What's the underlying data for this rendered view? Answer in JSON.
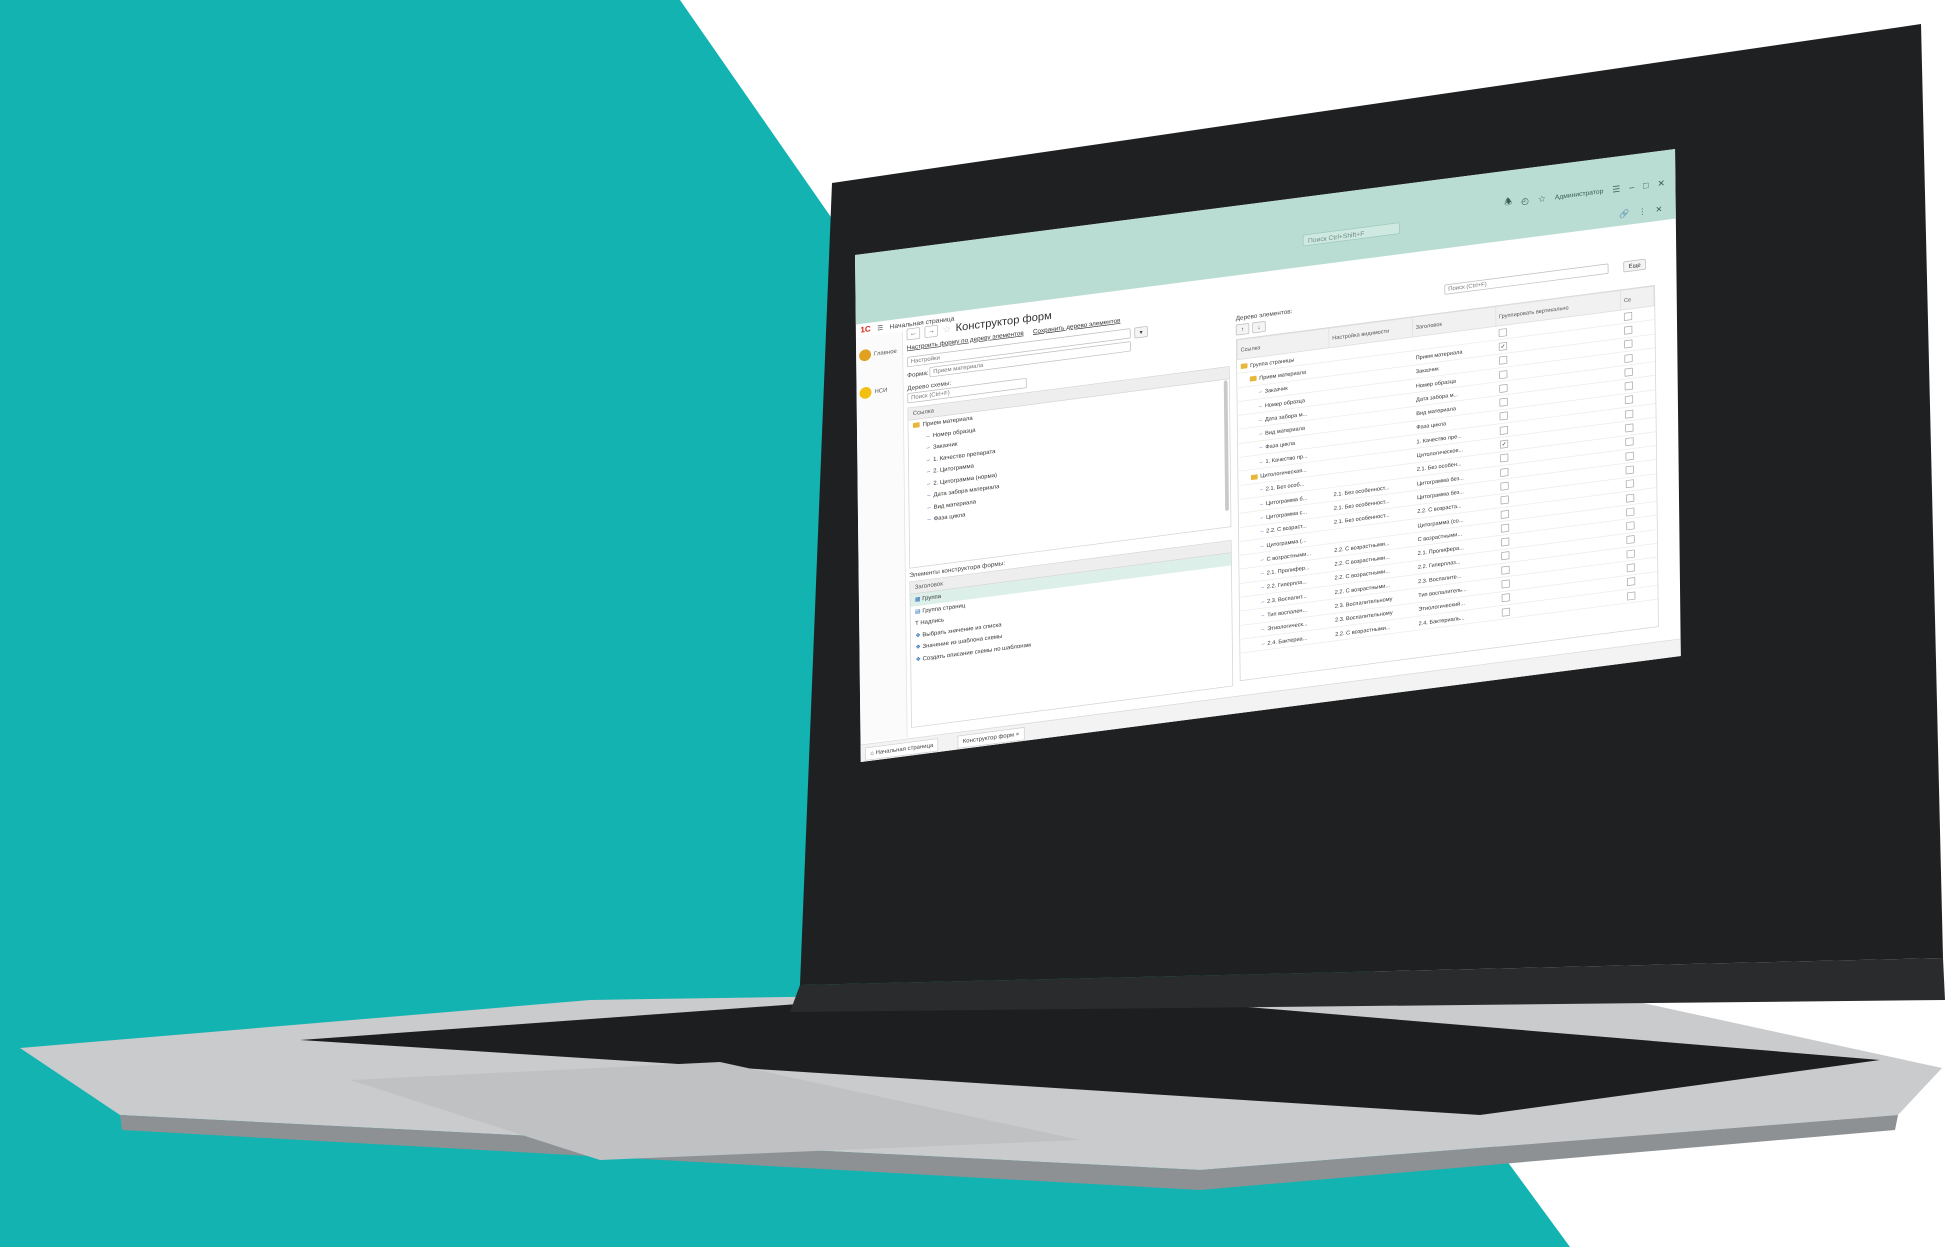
{
  "colors": {
    "teal_bg": "#12b3b1",
    "titlebar": "#b9ddd3",
    "laptop_bezel": "#1f2021",
    "laptop_body": "#cfd1d3"
  },
  "titlebar": {
    "search_placeholder": "Поиск Ctrl+Shift+F",
    "icons": [
      "bell-icon",
      "history-icon",
      "star-icon"
    ],
    "user_name": "Администратор",
    "window_icons": [
      "menu-icon",
      "minimize-icon",
      "maximize-icon",
      "close-icon"
    ],
    "right_icons": [
      "link-icon",
      "more-icon",
      "close-icon"
    ]
  },
  "topnav": {
    "logo": "1С",
    "title": "Начальная страница"
  },
  "rail": [
    {
      "label": "Главное",
      "icon": "home-icon",
      "color": "#e0a020"
    },
    {
      "label": "НСИ",
      "icon": "coin-icon",
      "color": "#f2c012"
    }
  ],
  "form": {
    "title": "Конструктор форм",
    "link1": "Настроить форму по дереву элементов",
    "link2": "Сохранить дерево элементов",
    "more_button": "Еще"
  },
  "left": {
    "settings_label": "Настройки",
    "form_label": "Форма:",
    "form_value": "Прием материала",
    "tree_label": "Дерево схемы:",
    "tree_search": "Поиск (Ctrl+F)",
    "tree_header": "Ссылка",
    "tree_rows": [
      {
        "text": "Прием материала",
        "level": 0,
        "type": "folder"
      },
      {
        "text": "Номер образца",
        "level": 1,
        "type": "item"
      },
      {
        "text": "Заказчик",
        "level": 1,
        "type": "item"
      },
      {
        "text": "1. Качество препарата",
        "level": 1,
        "type": "item"
      },
      {
        "text": "2. Цитограмма",
        "level": 1,
        "type": "item"
      },
      {
        "text": "2. Цитограмма (норма)",
        "level": 1,
        "type": "item"
      },
      {
        "text": "Дата забора материала",
        "level": 1,
        "type": "item"
      },
      {
        "text": "Вид материала",
        "level": 1,
        "type": "item"
      },
      {
        "text": "Фаза цикла",
        "level": 1,
        "type": "item"
      }
    ],
    "constructor_label": "Элементы конструктора формы:",
    "constructor_header": "Заголовок",
    "constructor_rows": [
      {
        "text": "Группа",
        "icon": "group-icon"
      },
      {
        "text": "Группа страниц",
        "icon": "pages-icon"
      },
      {
        "text": "Надпись",
        "icon": "text-icon"
      },
      {
        "text": "Выбрать значение из списка",
        "icon": "list-icon"
      },
      {
        "text": "Значение из шаблона схемы",
        "icon": "template-icon"
      },
      {
        "text": "Создать описание схемы по шаблонам",
        "icon": "create-icon"
      }
    ]
  },
  "right": {
    "tree_label": "Дерево элементов:",
    "search_placeholder": "Поиск (Ctrl+F)",
    "more_button": "Еще",
    "columns": [
      "Ссылка",
      "Настройка видимости",
      "Заголовок",
      "Группировать вертикально",
      "Се"
    ],
    "rows": [
      {
        "link": "Группа страницы",
        "vis": "",
        "title": "",
        "group": false,
        "level": 0,
        "folder": true
      },
      {
        "link": "Прием материала",
        "vis": "",
        "title": "Прием материала",
        "group": true,
        "level": 1,
        "folder": true
      },
      {
        "link": "Заказчик",
        "vis": "",
        "title": "Заказчик",
        "group": false,
        "level": 2,
        "folder": false
      },
      {
        "link": "Номер образца",
        "vis": "",
        "title": "Номер образца",
        "group": false,
        "level": 2,
        "folder": false
      },
      {
        "link": "Дата забора м...",
        "vis": "",
        "title": "Дата забора м...",
        "group": false,
        "level": 2,
        "folder": false
      },
      {
        "link": "Вид материала",
        "vis": "",
        "title": "Вид материала",
        "group": false,
        "level": 2,
        "folder": false
      },
      {
        "link": "Фаза цикла",
        "vis": "",
        "title": "Фаза цикла",
        "group": false,
        "level": 2,
        "folder": false
      },
      {
        "link": "1. Качество пр...",
        "vis": "",
        "title": "1. Качество пре...",
        "group": false,
        "level": 2,
        "folder": false
      },
      {
        "link": "Цитологическая...",
        "vis": "",
        "title": "Цитологическое...",
        "group": true,
        "level": 1,
        "folder": true
      },
      {
        "link": "2.1. Без особ...",
        "vis": "",
        "title": "2.1. Без особен...",
        "group": false,
        "level": 2,
        "folder": false
      },
      {
        "link": "Цитограмма б...",
        "vis": "2.1. Без особенност...",
        "title": "Цитограмма без...",
        "group": false,
        "level": 2,
        "folder": false
      },
      {
        "link": "Цитограмма с...",
        "vis": "2.1. Без особенност...",
        "title": "Цитограмма без...",
        "group": false,
        "level": 2,
        "folder": false
      },
      {
        "link": "2.2. С возраст...",
        "vis": "2.1. Без особенност...",
        "title": "2.2. С возраста...",
        "group": false,
        "level": 2,
        "folder": false
      },
      {
        "link": "Цитограмма (...",
        "vis": "",
        "title": "Цитограмма (со...",
        "group": false,
        "level": 2,
        "folder": false
      },
      {
        "link": "С возрастными...",
        "vis": "2.2. С возрастными...",
        "title": "С возрастными...",
        "group": false,
        "level": 2,
        "folder": false
      },
      {
        "link": "2.1. Пролифер...",
        "vis": "2.2. С возрастными...",
        "title": "2.1. Пролифера...",
        "group": false,
        "level": 2,
        "folder": false
      },
      {
        "link": "2.2. Гиперпла...",
        "vis": "2.2. С возрастными...",
        "title": "2.2. Гиперплаз...",
        "group": false,
        "level": 2,
        "folder": false
      },
      {
        "link": "2.3. Воспалит...",
        "vis": "2.2. С возрастными...",
        "title": "2.3. Воспалите...",
        "group": false,
        "level": 2,
        "folder": false
      },
      {
        "link": "Тип воспален...",
        "vis": "2.3. Воспалительному",
        "title": "Тип воспалитель...",
        "group": false,
        "level": 2,
        "folder": false
      },
      {
        "link": "Этиологическ...",
        "vis": "2.3. Воспалительному",
        "title": "Этиологический...",
        "group": false,
        "level": 2,
        "folder": false
      },
      {
        "link": "2.4. Бактериа...",
        "vis": "2.2. С возрастными...",
        "title": "2.4. Бактериаль...",
        "group": false,
        "level": 2,
        "folder": false
      }
    ]
  },
  "bottom_tabs": [
    "Начальная страница",
    "Конструктор форм"
  ]
}
